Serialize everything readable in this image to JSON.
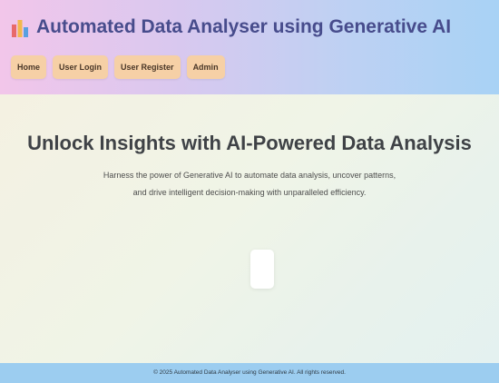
{
  "header": {
    "logo_icon": "bar-chart-icon",
    "title": "Automated Data Analyser using Generative AI",
    "nav": [
      {
        "label": "Home"
      },
      {
        "label": "User Login"
      },
      {
        "label": "User Register"
      },
      {
        "label": "Admin"
      }
    ]
  },
  "hero": {
    "title": "Unlock Insights with AI-Powered Data Analysis",
    "subtitle_line1": "Harness the power of Generative AI to automate data analysis, uncover patterns,",
    "subtitle_line2": "and drive intelligent decision-making with unparalleled efficiency."
  },
  "footer": {
    "text": "© 2025 Automated Data Analyser using Generative AI. All rights reserved."
  },
  "colors": {
    "header_gradient_start": "#f2c6ea",
    "header_gradient_end": "#a8d2f5",
    "title": "#474c8c",
    "nav_button": "#f6d0a6",
    "footer": "#9ccdf0"
  }
}
